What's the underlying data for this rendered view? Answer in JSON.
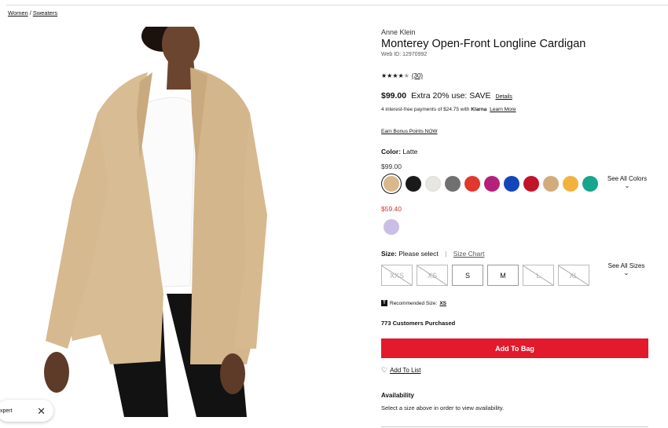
{
  "breadcrumb": {
    "items": [
      "Women",
      "Sweaters"
    ],
    "separator": "/"
  },
  "product": {
    "brand": "Anne Klein",
    "title": "Monterey Open-Front Longline Cardigan",
    "web_id": "Web ID: 12970992",
    "rating_stars": "★★★★",
    "rating_half": "★",
    "rating_value": 4.5,
    "review_count": "(30)",
    "price": "$99.00",
    "promo": "Extra 20% use: SAVE",
    "details_link": "Details",
    "klarna_text": "4 interest-free payments of $24.75 with",
    "klarna_brand": "Klarna",
    "klarna_link": "Learn More",
    "bonus_link": "Earn Bonus Points NOW"
  },
  "color": {
    "label": "Color:",
    "selected": "Latte",
    "regular_price": "$99.00",
    "swatches": [
      "#d9b88c",
      "#1a1a1a",
      "#e8e6e0",
      "#707070",
      "#e0382c",
      "#b5207a",
      "#1346b8",
      "#c0142a",
      "#d2ab7a",
      "#f2b33d",
      "#16a58e"
    ],
    "see_all": "See All Colors",
    "sale_price": "$59.40",
    "sale_swatch": "#c9bfe6"
  },
  "size": {
    "label": "Size:",
    "value": "Please select",
    "chart_link": "Size Chart",
    "options": [
      {
        "label": "XXS",
        "available": false
      },
      {
        "label": "XS",
        "available": false
      },
      {
        "label": "S",
        "available": true
      },
      {
        "label": "M",
        "available": true
      },
      {
        "label": "L",
        "available": false
      },
      {
        "label": "XL",
        "available": false
      }
    ],
    "see_all": "See All Sizes",
    "recommended_text": "Recommended Size:",
    "recommended_value": "XS"
  },
  "purchased": "773 Customers Purchased",
  "add_to_bag": "Add To Bag",
  "add_to_list": "Add To List",
  "availability": {
    "title": "Availability",
    "text": "Select a size above in order to view availability."
  },
  "expert_chip": {
    "text": "xpert"
  },
  "colors": {
    "accent_red": "#e21a2c",
    "sale_red": "#c0392b"
  }
}
